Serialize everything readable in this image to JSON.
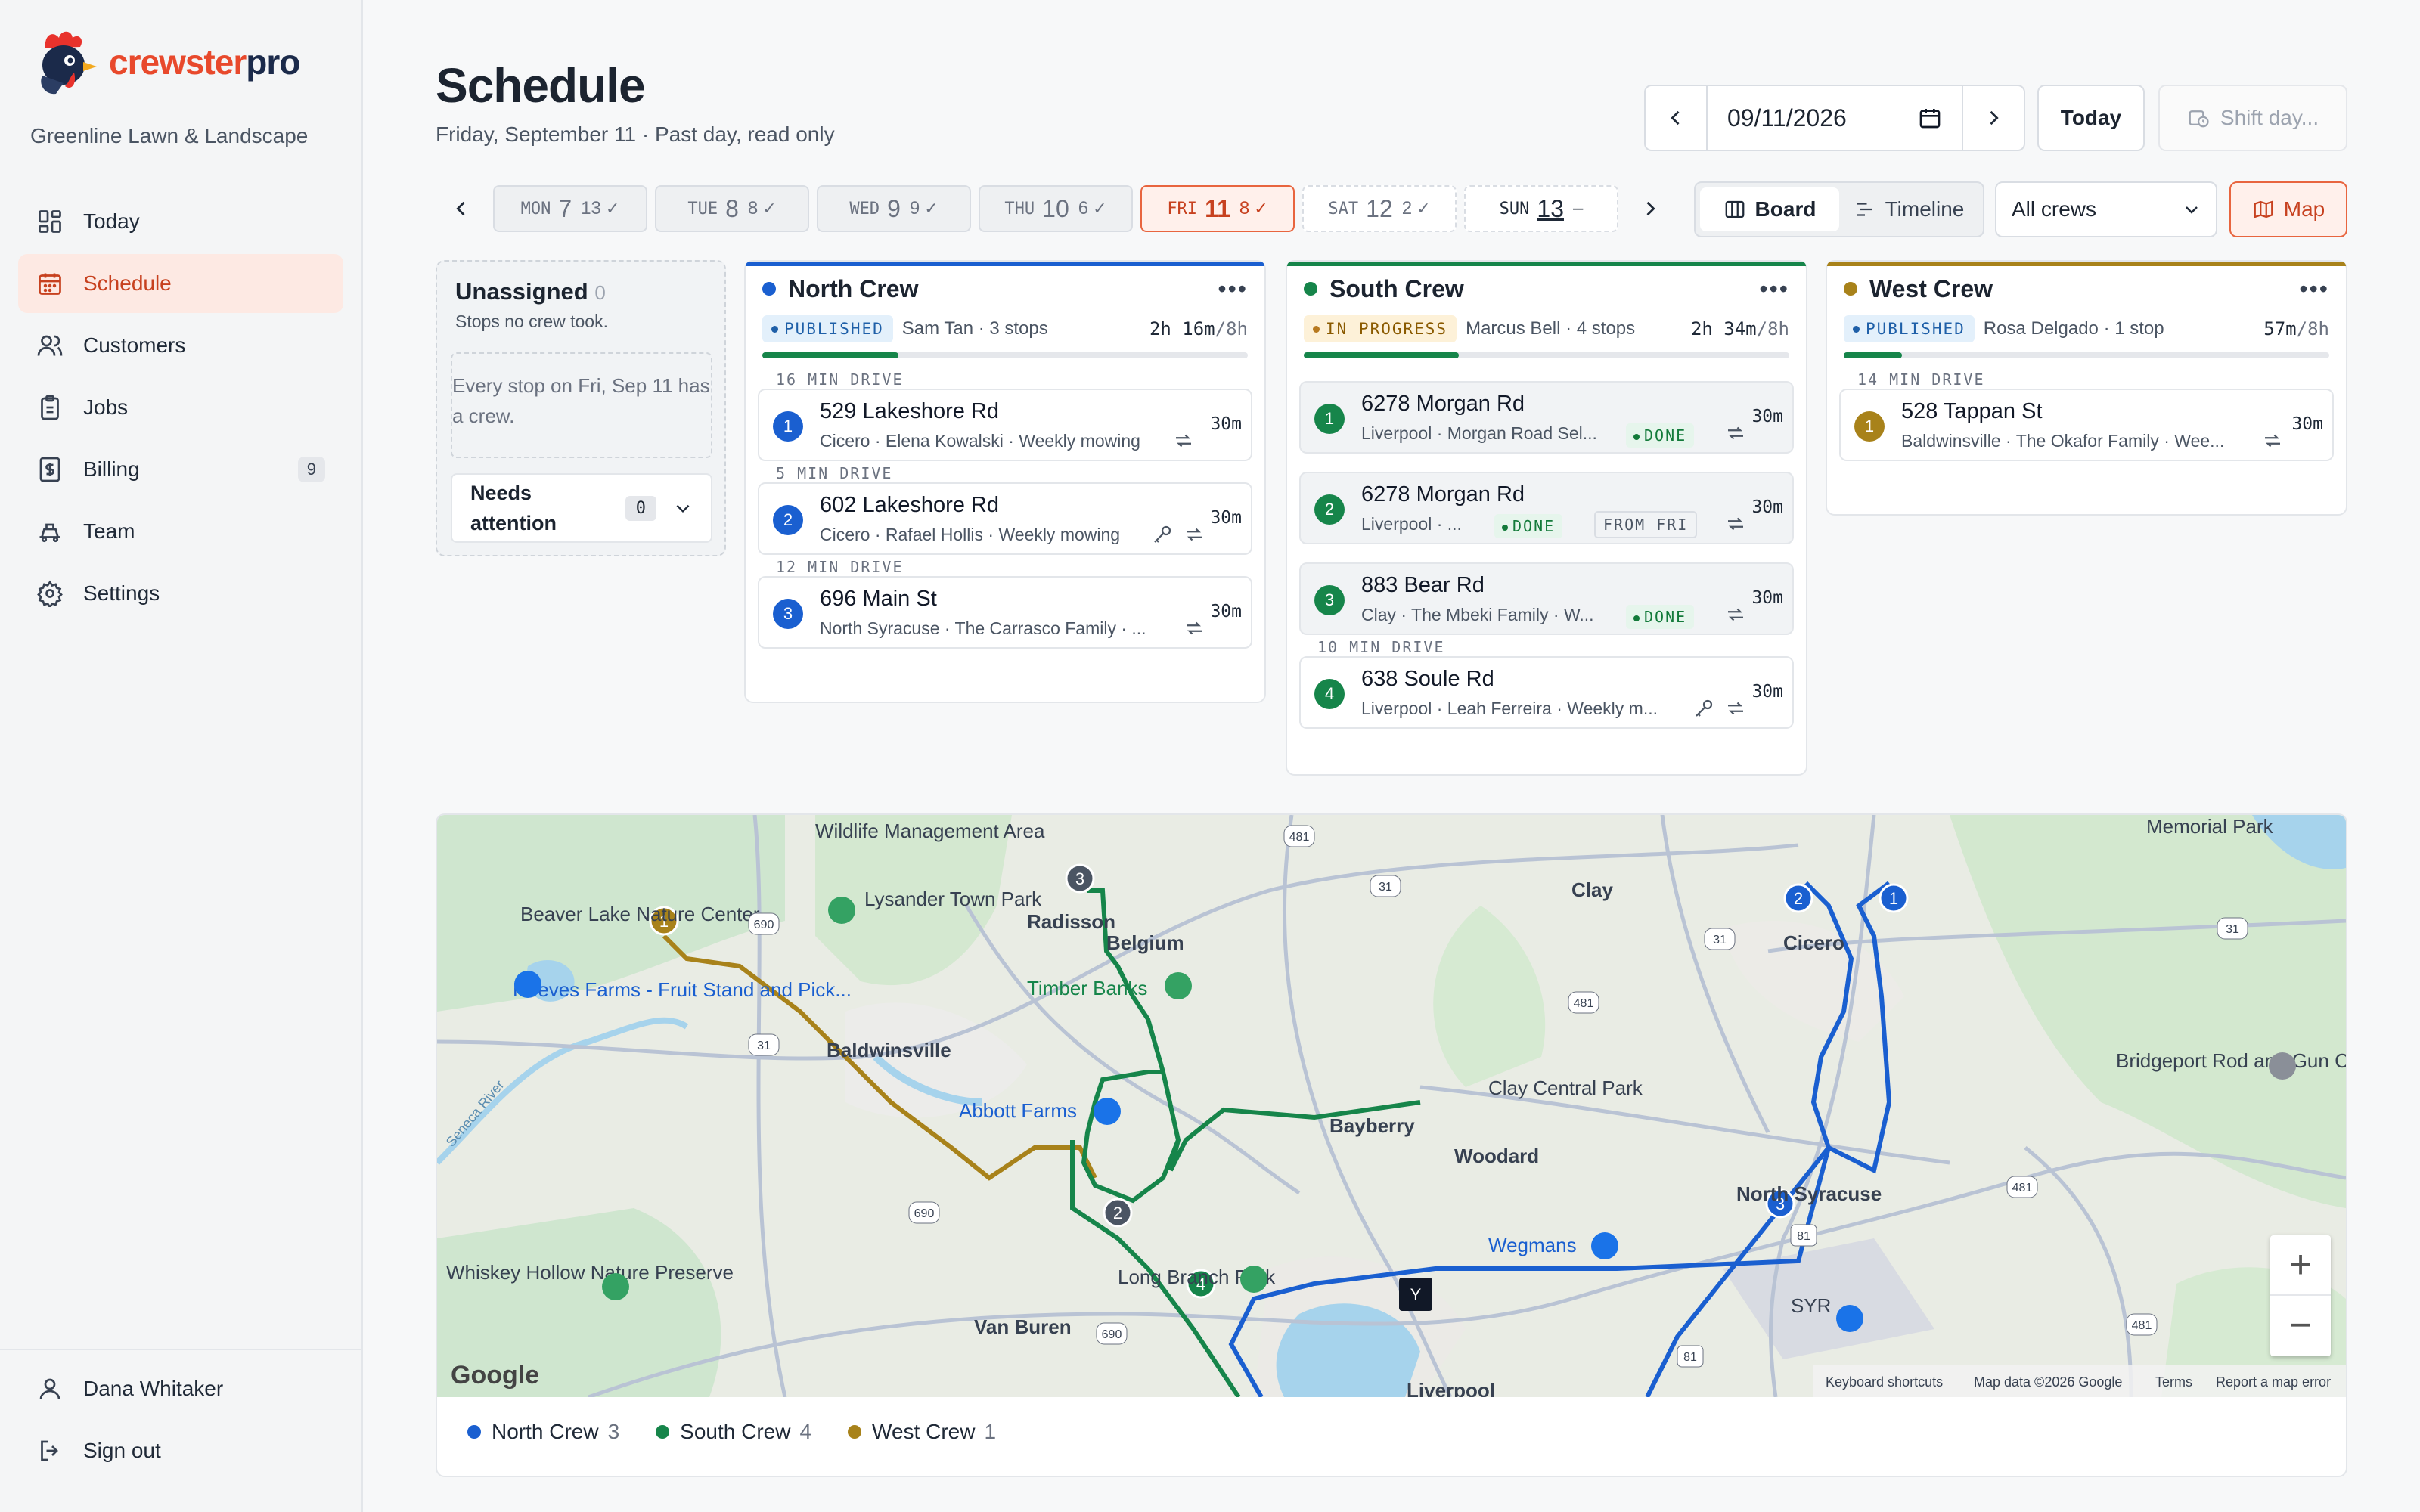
{
  "brand": {
    "name_a": "crewster",
    "name_b": "pro",
    "org": "Greenline Lawn & Landscape"
  },
  "nav": [
    {
      "label": "Today",
      "icon": "grid-icon"
    },
    {
      "label": "Schedule",
      "icon": "calendar-icon",
      "active": true
    },
    {
      "label": "Customers",
      "icon": "users-icon"
    },
    {
      "label": "Jobs",
      "icon": "clipboard-icon"
    },
    {
      "label": "Billing",
      "icon": "invoice-icon",
      "badge": "9"
    },
    {
      "label": "Team",
      "icon": "team-icon"
    },
    {
      "label": "Settings",
      "icon": "gear-icon"
    }
  ],
  "user": {
    "name": "Dana Whitaker",
    "signout": "Sign out"
  },
  "header": {
    "title": "Schedule",
    "subtitle": "Friday, September 11 · Past day, read only",
    "date": "09/11/2026",
    "today": "Today",
    "shift": "Shift day..."
  },
  "days": [
    {
      "dow": "MON",
      "num": "7",
      "count": "13"
    },
    {
      "dow": "TUE",
      "num": "8",
      "count": "8"
    },
    {
      "dow": "WED",
      "num": "9",
      "count": "9"
    },
    {
      "dow": "THU",
      "num": "10",
      "count": "6"
    },
    {
      "dow": "FRI",
      "num": "11",
      "count": "8"
    },
    {
      "dow": "SAT",
      "num": "12",
      "count": "2"
    },
    {
      "dow": "SUN",
      "num": "13",
      "count": "–"
    }
  ],
  "views": {
    "board": "Board",
    "timeline": "Timeline",
    "filter": "All crews",
    "map": "Map"
  },
  "unassigned": {
    "title": "Unassigned",
    "count": "0",
    "sub": "Stops no crew took.",
    "empty": "Every stop on Fri, Sep 11 has a crew.",
    "attention": "Needs attention",
    "attention_count": "0"
  },
  "crews": [
    {
      "name": "North Crew",
      "color": "#1a5fd0",
      "status": "PUBLISHED",
      "meta": "Sam Tan · 3 stops",
      "dur": "2h 16m",
      "cap": "/8h",
      "progress": 0.28,
      "stops": [
        {
          "drive": "16 MIN DRIVE",
          "addr": "529 Lakeshore Rd",
          "det": "Cicero · Elena Kowalski · Weekly mowing",
          "min": "30m"
        },
        {
          "drive": "5 MIN DRIVE",
          "addr": "602 Lakeshore Rd",
          "det": "Cicero · Rafael Hollis · Weekly mowing",
          "min": "30m"
        },
        {
          "drive": "12 MIN DRIVE",
          "addr": "696 Main St",
          "det": "North Syracuse · The Carrasco Family · ...",
          "min": "30m"
        }
      ]
    },
    {
      "name": "South Crew",
      "color": "#16854a",
      "status": "IN PROGRESS",
      "meta": "Marcus Bell · 4 stops",
      "dur": "2h 34m",
      "cap": "/8h",
      "progress": 0.32,
      "stops": [
        {
          "addr": "6278 Morgan Rd",
          "det": "Liverpool · Morgan Road Sel...",
          "tag": "DONE",
          "min": "30m"
        },
        {
          "addr": "6278 Morgan Rd",
          "det": "Liverpool · ...",
          "tag": "DONE",
          "tag2": "FROM FRI",
          "min": "30m"
        },
        {
          "addr": "883 Bear Rd",
          "det": "Clay · The Mbeki Family · W...",
          "tag": "DONE",
          "min": "30m"
        },
        {
          "drive": "10 MIN DRIVE",
          "addr": "638 Soule Rd",
          "det": "Liverpool · Leah Ferreira · Weekly m...",
          "min": "30m"
        }
      ]
    },
    {
      "name": "West Crew",
      "color": "#a8821a",
      "status": "PUBLISHED",
      "meta": "Rosa Delgado · 1 stop",
      "dur": "57m",
      "cap": "/8h",
      "progress": 0.12,
      "stops": [
        {
          "drive": "14 MIN DRIVE",
          "addr": "528 Tappan St",
          "det": "Baldwinsville · The Okafor Family · Wee...",
          "min": "30m"
        }
      ]
    }
  ],
  "map": {
    "places": [
      "Wildlife Management Area",
      "Beaver Lake Nature Center",
      "Lysander Town Park",
      "Radisson",
      "Belgium",
      "Reeves Farms - Fruit Stand and Pick...",
      "Timber Banks",
      "Baldwinsville",
      "Abbott Farms",
      "Seneca River",
      "Clay",
      "Cicero",
      "Memorial Park",
      "Clay Central Park",
      "Bayberry",
      "Woodard",
      "Wegmans",
      "North Syracuse",
      "Bridgeport Rod and Gun Club",
      "Whiskey Hollow Nature Preserve",
      "Long Branch Park",
      "Van Buren",
      "SYR",
      "Liverpool"
    ],
    "shields": [
      "690",
      "31",
      "481",
      "31",
      "31",
      "481",
      "690",
      "690",
      "481",
      "31",
      "481",
      "81",
      "81"
    ],
    "footer": {
      "google": "Google",
      "shortcuts": "Keyboard shortcuts",
      "mapdata": "Map data ©2026 Google",
      "terms": "Terms",
      "report": "Report a map error"
    },
    "home_marker": "Y"
  },
  "legend": [
    {
      "name": "North Crew",
      "count": "3",
      "color": "#1a5fd0"
    },
    {
      "name": "South Crew",
      "count": "4",
      "color": "#16854a"
    },
    {
      "name": "West Crew",
      "count": "1",
      "color": "#a8821a"
    }
  ]
}
